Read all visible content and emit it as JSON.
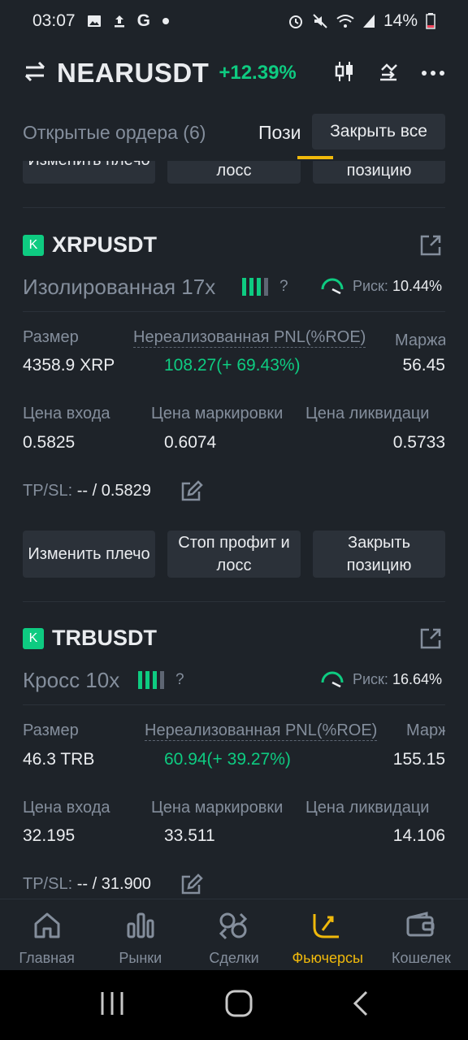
{
  "status_bar": {
    "time": "03:07",
    "battery": "14%"
  },
  "header": {
    "pair": "NEARUSDT",
    "change": "+12.39%"
  },
  "tabs": {
    "open_orders": "Открытые ордера (6)",
    "positions": "Пози"
  },
  "close_all": "Закрыть все",
  "action_labels": {
    "change_leverage": "Изменить плечо",
    "stop_profit_line1": "Стоп профит и",
    "stop_profit_line2": "лосс",
    "close_line1": "Закрыть",
    "close_line2": "позицию"
  },
  "partial_buttons": {
    "change_leverage": "Изменить плечо",
    "stop_loss": "лосс",
    "close": "позицию"
  },
  "labels": {
    "size": "Размер",
    "pnl": "Нереализованная PNL(%ROE)",
    "margin_trunc_1": "Маржа",
    "margin_trunc_2": "Марж",
    "entry": "Цена входа",
    "mark": "Цена маркировки",
    "liq": "Цена ликвидаци",
    "tpsl": "TP/SL:",
    "risk": "Риск:"
  },
  "positions": [
    {
      "symbol": "XRPUSDT",
      "badge": "K",
      "mode": "Изолированная 17x",
      "risk": "10.44%",
      "size": "4358.9 XRP",
      "pnl": "108.27(+ 69.43%)",
      "margin": "56.45",
      "entry": "0.5825",
      "mark": "0.6074",
      "liq": "0.5733",
      "tpsl": "-- / 0.5829"
    },
    {
      "symbol": "TRBUSDT",
      "badge": "K",
      "mode": "Кросс 10x",
      "risk": "16.64%",
      "size": "46.3 TRB",
      "pnl": "60.94(+ 39.27%)",
      "margin": "155.15",
      "entry": "32.195",
      "mark": "33.511",
      "liq": "14.106",
      "tpsl": "-- / 31.900"
    }
  ],
  "nav": {
    "home": "Главная",
    "markets": "Рынки",
    "trades": "Сделки",
    "futures": "Фьючерсы",
    "wallet": "Кошелек"
  },
  "colors": {
    "accent": "#f0b90b",
    "green": "#0ecb81",
    "bg": "#1e2329",
    "panel": "#2b3139"
  }
}
